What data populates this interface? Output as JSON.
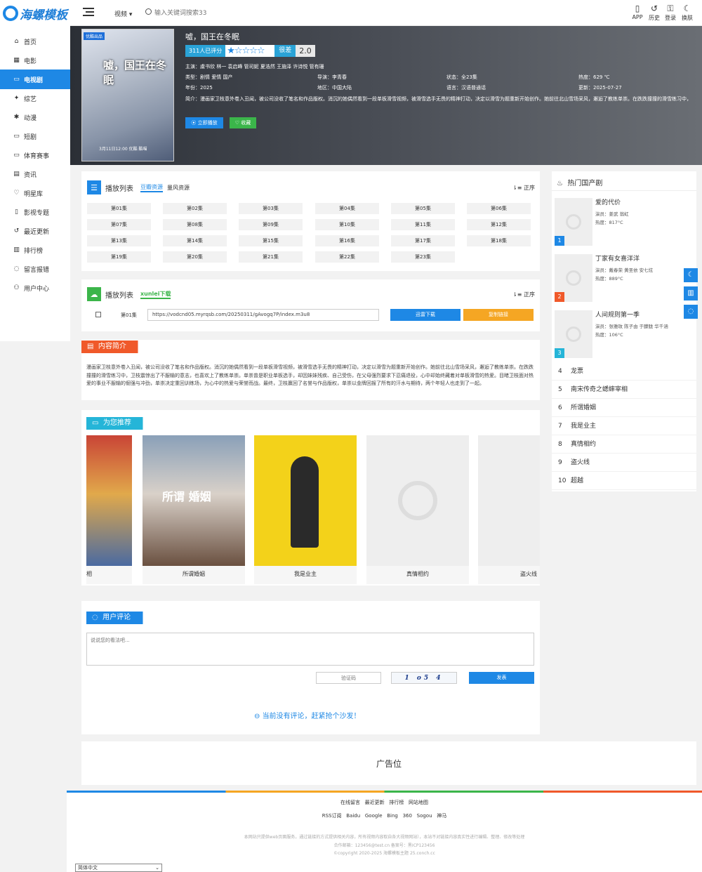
{
  "logo": {
    "text": "海螺模板"
  },
  "header": {
    "nav_label": "视频",
    "search_placeholder": "输入关键词搜索33",
    "tools": [
      {
        "icon": "phone-icon",
        "glyph": "▯",
        "label": "APP"
      },
      {
        "icon": "history-icon",
        "glyph": "↺",
        "label": "历史"
      },
      {
        "icon": "lock-icon",
        "glyph": "⚿",
        "label": "登录"
      },
      {
        "icon": "moon-icon",
        "glyph": "☾",
        "label": "换肤"
      }
    ]
  },
  "sidebar": {
    "items": [
      {
        "icon": "home-icon",
        "glyph": "⌂",
        "label": "首页"
      },
      {
        "icon": "film-icon",
        "glyph": "▦",
        "label": "电影"
      },
      {
        "icon": "tv-icon",
        "glyph": "▭",
        "label": "电视剧",
        "active": true
      },
      {
        "icon": "star-icon",
        "glyph": "✦",
        "label": "综艺"
      },
      {
        "icon": "paw-icon",
        "glyph": "✱",
        "label": "动漫"
      },
      {
        "icon": "monitor-icon",
        "glyph": "▭",
        "label": "短剧"
      },
      {
        "icon": "monitor-icon",
        "glyph": "▭",
        "label": "体育赛事"
      },
      {
        "icon": "file-icon",
        "glyph": "▤",
        "label": "资讯"
      },
      {
        "icon": "heart-icon",
        "glyph": "♡",
        "label": "明星库"
      },
      {
        "icon": "bookmark-icon",
        "glyph": "▯",
        "label": "影视专题"
      },
      {
        "icon": "history-icon",
        "glyph": "↺",
        "label": "最近更新"
      },
      {
        "icon": "bar-chart-icon",
        "glyph": "▥",
        "label": "排行榜"
      },
      {
        "icon": "comment-icon",
        "glyph": "◌",
        "label": "留言报错"
      },
      {
        "icon": "user-icon",
        "glyph": "⚇",
        "label": "用户中心"
      }
    ]
  },
  "detail": {
    "poster_tag": "优酷出品",
    "poster_title": "嘘，国王在冬眠",
    "poster_foot": "3月11日12:00 优酷 酷喵",
    "title": "嘘，国王在冬眠",
    "rating_count": "311人已评分",
    "stars": "★☆☆☆☆",
    "rating_word": "很差",
    "score": "2.0",
    "cast": "主演：虞书欣 林一 袁启峰 管司妮 夏浩然 王施泽 许诗悦 管有珊",
    "director": "导演：李青春",
    "type": "类型：剧情 爱情 国产",
    "status": "状态：全23集",
    "heat": "热度：629 ℃",
    "year": "年份：2025",
    "area": "地区：中国大陆",
    "lang": "语言：汉语普通话",
    "updated": "更新：2025-07-27",
    "intro": "简介：漫画家卫枝意外卷入丑闻，被公司没收了笔名和作品版权。消沉的她偶然看到一段单板滑雪视频，被滑雪选手无畏的精神打动，决定以滑雪为题重新开始创作。她前往北山雪场采风，邂逅了教练单崇。在跌跌撞撞的滑雪练习中，",
    "play_btn": "⦿ 立即播放",
    "fav_btn": "♡ 收藏"
  },
  "playlist1": {
    "title": "播放列表",
    "tabs": [
      "豆瓣资源",
      "量风资源"
    ],
    "order": "正序",
    "episodes": [
      "第01集",
      "第02集",
      "第03集",
      "第04集",
      "第05集",
      "第06集",
      "第07集",
      "第08集",
      "第09集",
      "第10集",
      "第11集",
      "第12集",
      "第13集",
      "第14集",
      "第15集",
      "第16集",
      "第17集",
      "第18集",
      "第19集",
      "第20集",
      "第21集",
      "第22集",
      "第23集"
    ]
  },
  "playlist2": {
    "title": "播放列表",
    "tab": "xunlei下载",
    "order": "正序",
    "episode": "第01集",
    "url": "https://vodcnd05.myrqsb.com/20250311/gAvogq7P/index.m3u8",
    "download_btn": "迅雷下载",
    "copy_btn": "复制链接"
  },
  "intro": {
    "title": "内容简介",
    "text": "漫画家卫枝意外卷入丑闻，被公司没收了笔名和作品版权。消沉的她偶然看到一段单板滑雪视频，被滑雪选手无畏的精神打动，决定以滑雪为题重新开始创作。她前往北山雪场采风，邂逅了教练单崇。在跌跌撞撞的滑雪练习中，卫枝震惊出了不服输的意志，也喜欢上了教练单崇。单崇曾是职业单板选手，却因妹妹残疾、自己受伤，在父母强烈要求下忍痛退役，心中却始终藏着对单板滑雪的热爱。目睹卫枝面对热爱的事业不服输的倔强与冲劲，单崇决定重回训练场，为心中的热爱与荣誉而战。最终，卫枝赢回了名誉与作品版权，单崇以金牌回报了所有的汗水与期待，两个年轻人也走到了一起。"
  },
  "recommend": {
    "title": "为您推荐",
    "items": [
      "蜉蝣宰相",
      "所谓婚姻",
      "我是业主",
      "真情相约",
      "盗火线"
    ]
  },
  "comments": {
    "title": "用户评论",
    "placeholder": "说说您的看法吧...",
    "captcha_placeholder": "验证码",
    "captcha_text": "1 o5 4",
    "submit": "发表",
    "empty": "当前没有评论，赶紧抢个沙发！"
  },
  "hot": {
    "title": "热门国产剧",
    "top": [
      {
        "rank": "1",
        "title": "爱的代价",
        "cast": "演员：姜武 翁虹",
        "heat": "热度：817°C"
      },
      {
        "rank": "2",
        "title": "丁家有女喜洋洋",
        "cast": "演员：戴春荣 黄圣依 安七炫",
        "heat": "热度：889°C"
      },
      {
        "rank": "3",
        "title": "人间规则第一季",
        "cast": "演员：张雅玫 陈子由 于朦胧 华千涵",
        "heat": "热度：106°C"
      }
    ],
    "list": [
      {
        "rank": "4",
        "title": "龙票"
      },
      {
        "rank": "5",
        "title": "南宋传奇之蟋蟀宰相"
      },
      {
        "rank": "6",
        "title": "所谓婚姻"
      },
      {
        "rank": "7",
        "title": "我是业主"
      },
      {
        "rank": "8",
        "title": "真情相约"
      },
      {
        "rank": "9",
        "title": "盗火线"
      },
      {
        "rank": "10",
        "title": "超越"
      }
    ]
  },
  "ad": {
    "text": "广告位"
  },
  "footer": {
    "links1": [
      "在线留言",
      "最近更新",
      "排行榜",
      "网站地图"
    ],
    "links2": [
      "RSS订阅",
      "Baidu",
      "Google",
      "Bing",
      "360",
      "Sogou",
      "神马"
    ],
    "disclaimer": "本网站只提供web页面服务，通过链接的方式提供相关内容，所有视频内容取自各大视频网站），本站不对链接内容真实性进行编辑、整理、修改等处理",
    "contact": "合作邮箱：123456@test.cn 备案号：黑ICP123456",
    "copyright": "©copyright 2020-2025 海螺模板主题 25.conch.cc"
  },
  "lang_select": "简体中文",
  "colors": {
    "accent": "#1e88e5",
    "orange": "#f5a623",
    "green": "#3bb54a",
    "red": "#f0592a"
  }
}
